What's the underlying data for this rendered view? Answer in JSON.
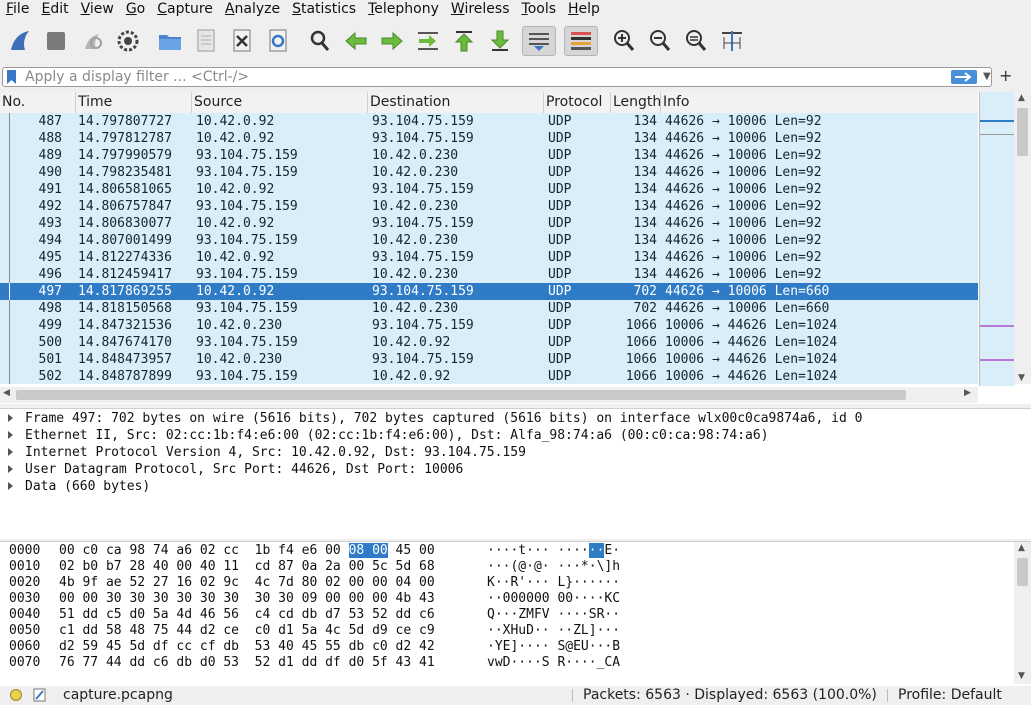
{
  "menubar": [
    {
      "u": "F",
      "rest": "ile"
    },
    {
      "u": "E",
      "rest": "dit"
    },
    {
      "u": "V",
      "rest": "iew"
    },
    {
      "u": "G",
      "rest": "o"
    },
    {
      "u": "C",
      "rest": "apture"
    },
    {
      "u": "A",
      "rest": "nalyze"
    },
    {
      "u": "S",
      "rest": "tatistics"
    },
    {
      "u": "T",
      "rest": "elephony"
    },
    {
      "u": "W",
      "rest": "ireless"
    },
    {
      "u": "T",
      "rest": "ools"
    },
    {
      "u": "H",
      "rest": "elp"
    }
  ],
  "toolbar_icons": [
    "shark-fin-icon",
    "stop-icon",
    "restart-icon",
    "options-gear-icon",
    "open-folder-icon",
    "file-icon",
    "close-file-icon",
    "reload-icon",
    "find-icon",
    "back-arrow-icon",
    "forward-arrow-icon",
    "go-to-packet-icon",
    "first-packet-icon",
    "last-packet-icon",
    "autoscroll-icon",
    "colorize-icon",
    "zoom-in-icon",
    "zoom-out-icon",
    "zoom-normal-icon",
    "resize-columns-icon"
  ],
  "filter": {
    "placeholder": "Apply a display filter ... <Ctrl-/>"
  },
  "columns": [
    "No.",
    "Time",
    "Source",
    "Destination",
    "Protocol",
    "Length",
    "Info"
  ],
  "packets": [
    {
      "no": "487",
      "time": "14.797807727",
      "src": "10.42.0.92",
      "dst": "93.104.75.159",
      "proto": "UDP",
      "len": "134",
      "info": "44626 → 10006 Len=92"
    },
    {
      "no": "488",
      "time": "14.797812787",
      "src": "10.42.0.92",
      "dst": "93.104.75.159",
      "proto": "UDP",
      "len": "134",
      "info": "44626 → 10006 Len=92"
    },
    {
      "no": "489",
      "time": "14.797990579",
      "src": "93.104.75.159",
      "dst": "10.42.0.230",
      "proto": "UDP",
      "len": "134",
      "info": "44626 → 10006 Len=92"
    },
    {
      "no": "490",
      "time": "14.798235481",
      "src": "93.104.75.159",
      "dst": "10.42.0.230",
      "proto": "UDP",
      "len": "134",
      "info": "44626 → 10006 Len=92"
    },
    {
      "no": "491",
      "time": "14.806581065",
      "src": "10.42.0.92",
      "dst": "93.104.75.159",
      "proto": "UDP",
      "len": "134",
      "info": "44626 → 10006 Len=92"
    },
    {
      "no": "492",
      "time": "14.806757847",
      "src": "93.104.75.159",
      "dst": "10.42.0.230",
      "proto": "UDP",
      "len": "134",
      "info": "44626 → 10006 Len=92"
    },
    {
      "no": "493",
      "time": "14.806830077",
      "src": "10.42.0.92",
      "dst": "93.104.75.159",
      "proto": "UDP",
      "len": "134",
      "info": "44626 → 10006 Len=92"
    },
    {
      "no": "494",
      "time": "14.807001499",
      "src": "93.104.75.159",
      "dst": "10.42.0.230",
      "proto": "UDP",
      "len": "134",
      "info": "44626 → 10006 Len=92"
    },
    {
      "no": "495",
      "time": "14.812274336",
      "src": "10.42.0.92",
      "dst": "93.104.75.159",
      "proto": "UDP",
      "len": "134",
      "info": "44626 → 10006 Len=92"
    },
    {
      "no": "496",
      "time": "14.812459417",
      "src": "93.104.75.159",
      "dst": "10.42.0.230",
      "proto": "UDP",
      "len": "134",
      "info": "44626 → 10006 Len=92"
    },
    {
      "no": "497",
      "time": "14.817869255",
      "src": "10.42.0.92",
      "dst": "93.104.75.159",
      "proto": "UDP",
      "len": "702",
      "info": "44626 → 10006 Len=660",
      "selected": true
    },
    {
      "no": "498",
      "time": "14.818150568",
      "src": "93.104.75.159",
      "dst": "10.42.0.230",
      "proto": "UDP",
      "len": "702",
      "info": "44626 → 10006 Len=660"
    },
    {
      "no": "499",
      "time": "14.847321536",
      "src": "10.42.0.230",
      "dst": "93.104.75.159",
      "proto": "UDP",
      "len": "1066",
      "info": "10006 → 44626 Len=1024"
    },
    {
      "no": "500",
      "time": "14.847674170",
      "src": "93.104.75.159",
      "dst": "10.42.0.92",
      "proto": "UDP",
      "len": "1066",
      "info": "10006 → 44626 Len=1024"
    },
    {
      "no": "501",
      "time": "14.848473957",
      "src": "10.42.0.230",
      "dst": "93.104.75.159",
      "proto": "UDP",
      "len": "1066",
      "info": "10006 → 44626 Len=1024"
    },
    {
      "no": "502",
      "time": "14.848787899",
      "src": "93.104.75.159",
      "dst": "10.42.0.92",
      "proto": "UDP",
      "len": "1066",
      "info": "10006 → 44626 Len=1024"
    }
  ],
  "details": [
    "Frame 497: 702 bytes on wire (5616 bits), 702 bytes captured (5616 bits) on interface wlx00c0ca9874a6, id 0",
    "Ethernet II, Src: 02:cc:1b:f4:e6:00 (02:cc:1b:f4:e6:00), Dst: Alfa_98:74:a6 (00:c0:ca:98:74:a6)",
    "Internet Protocol Version 4, Src: 10.42.0.92, Dst: 93.104.75.159",
    "User Datagram Protocol, Src Port: 44626, Dst Port: 10006",
    "Data (660 bytes)"
  ],
  "hex": [
    {
      "off": "0000",
      "pre": "00 c0 ca 98 74 a6 02 cc  1b f4 e6 00 ",
      "hl": "08 00",
      "post": " 45 00",
      "apre": "····t··· ····",
      "ahl": "··",
      "apost": "E·"
    },
    {
      "off": "0010",
      "pre": "02 b0 b7 28 40 00 40 11  cd 87 0a 2a 00 5c 5d 68",
      "hl": "",
      "post": "",
      "apre": "···(@·@· ···*·\\]h",
      "ahl": "",
      "apost": ""
    },
    {
      "off": "0020",
      "pre": "4b 9f ae 52 27 16 02 9c  4c 7d 80 02 00 00 04 00",
      "hl": "",
      "post": "",
      "apre": "K··R'··· L}······",
      "ahl": "",
      "apost": ""
    },
    {
      "off": "0030",
      "pre": "00 00 30 30 30 30 30 30  30 30 09 00 00 00 4b 43",
      "hl": "",
      "post": "",
      "apre": "··000000 00····KC",
      "ahl": "",
      "apost": ""
    },
    {
      "off": "0040",
      "pre": "51 dd c5 d0 5a 4d 46 56  c4 cd db d7 53 52 dd c6",
      "hl": "",
      "post": "",
      "apre": "Q···ZMFV ····SR··",
      "ahl": "",
      "apost": ""
    },
    {
      "off": "0050",
      "pre": "c1 dd 58 48 75 44 d2 ce  c0 d1 5a 4c 5d d9 ce c9",
      "hl": "",
      "post": "",
      "apre": "··XHuD·· ··ZL]···",
      "ahl": "",
      "apost": ""
    },
    {
      "off": "0060",
      "pre": "d2 59 45 5d df cc cf db  53 40 45 55 db c0 d2 42",
      "hl": "",
      "post": "",
      "apre": "·YE]···· S@EU···B",
      "ahl": "",
      "apost": ""
    },
    {
      "off": "0070",
      "pre": "76 77 44 dd c6 db d0 53  52 d1 dd df d0 5f 43 41",
      "hl": "",
      "post": "",
      "apre": "vwD····S R····_CA",
      "ahl": "",
      "apost": ""
    }
  ],
  "status": {
    "file": "capture.pcapng",
    "packets": "Packets: 6563 · Displayed: 6563 (100.0%)",
    "profile": "Profile: Default"
  },
  "colors": {
    "row_bg": "#daeefa",
    "selected_bg": "#2f7bc5",
    "accent": "#4a90d9"
  }
}
